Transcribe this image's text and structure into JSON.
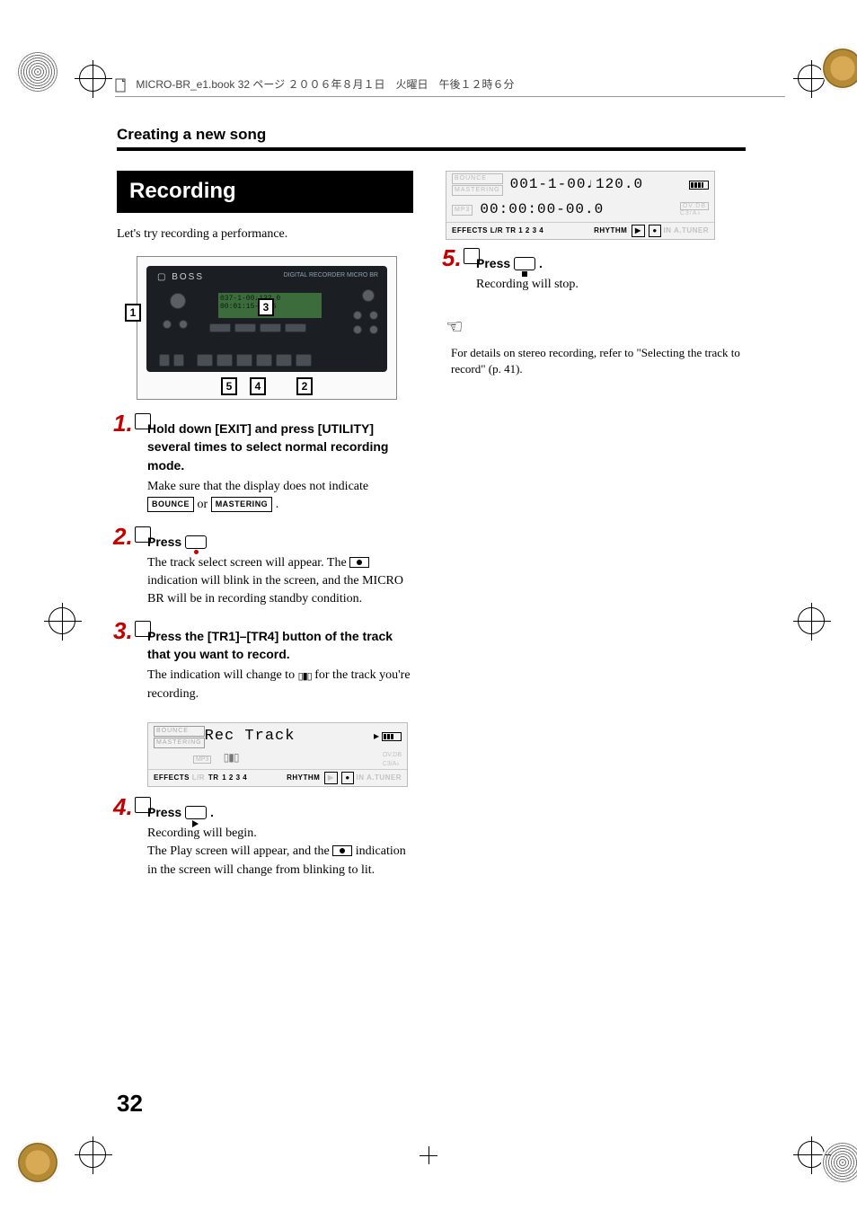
{
  "print_header": "MICRO-BR_e1.book 32 ページ ２００６年８月１日　火曜日　午後１２時６分",
  "page_title": "Creating a new song",
  "page_number": "32",
  "section_title": "Recording",
  "intro": "Let's try recording a performance.",
  "device": {
    "brand": "BOSS",
    "model_text": "DIGITAL RECORDER MICRO BR",
    "screen_line1": "037-1-00♩132.0",
    "screen_line2": "00:01:15-13.6",
    "callouts": {
      "c1": "1",
      "c2": "2",
      "c3": "3",
      "c4": "4",
      "c5": "5"
    }
  },
  "steps": {
    "s1": {
      "num": "1.",
      "heading": "Hold down [EXIT] and press [UTILITY] several times to select normal recording mode.",
      "body1": "Make sure that the display does not indicate",
      "box_bounce": "BOUNCE",
      "or": " or ",
      "box_mastering": "MASTERING",
      "body_end": " ."
    },
    "s2": {
      "num": "2.",
      "heading_pre": "Press ",
      "body1": "The track select screen will appear. The ",
      "body2": " indication will blink in the screen, and the MICRO BR will be in recording standby condition."
    },
    "s3": {
      "num": "3.",
      "heading": "Press the [TR1]–[TR4] button of the track that you want to record.",
      "body1": "The indication will change to ",
      "rec_icon": "REC",
      "body2": " for the track you're recording."
    },
    "s4": {
      "num": "4.",
      "heading_pre": "Press ",
      "heading_post": " .",
      "body1": "Recording will begin.",
      "body2a": "The Play screen will appear, and the ",
      "body2b": " indication in the screen will change from blinking to lit."
    },
    "s5": {
      "num": "5.",
      "heading_pre": "Press ",
      "heading_post": " .",
      "body": "Recording will stop."
    }
  },
  "lcd_rectrack": {
    "side1": "BOUNCE",
    "side2": "MASTERING",
    "side3": "MP3",
    "title": "Rec Track",
    "bottom_effects": "EFFECTS",
    "bottom_lr": "L/R",
    "bottom_tr": "TR",
    "bottom_nums": "1  2  3  4",
    "bottom_rhythm": "RHYTHM",
    "bottom_in": "IN",
    "bottom_tuner": "A.TUNER"
  },
  "lcd_play": {
    "side1": "BOUNCE",
    "side2": "MASTERING",
    "side3": "MP3",
    "line1": "001-1-00♩120.0",
    "line2": "00:00:00-00.0",
    "ovdb": "OV.DB",
    "csab": "C3/A♭",
    "bottom_effects": "EFFECTS",
    "bottom_lr": "L/R",
    "bottom_tr": "TR",
    "bottom_nums": "1  2  3  4",
    "bottom_rhythm": "RHYTHM",
    "bottom_in": "IN",
    "bottom_tuner": "A.TUNER"
  },
  "hint": {
    "body": "For details on stereo recording, refer to \"Selecting the track to record\" (p. 41)."
  }
}
